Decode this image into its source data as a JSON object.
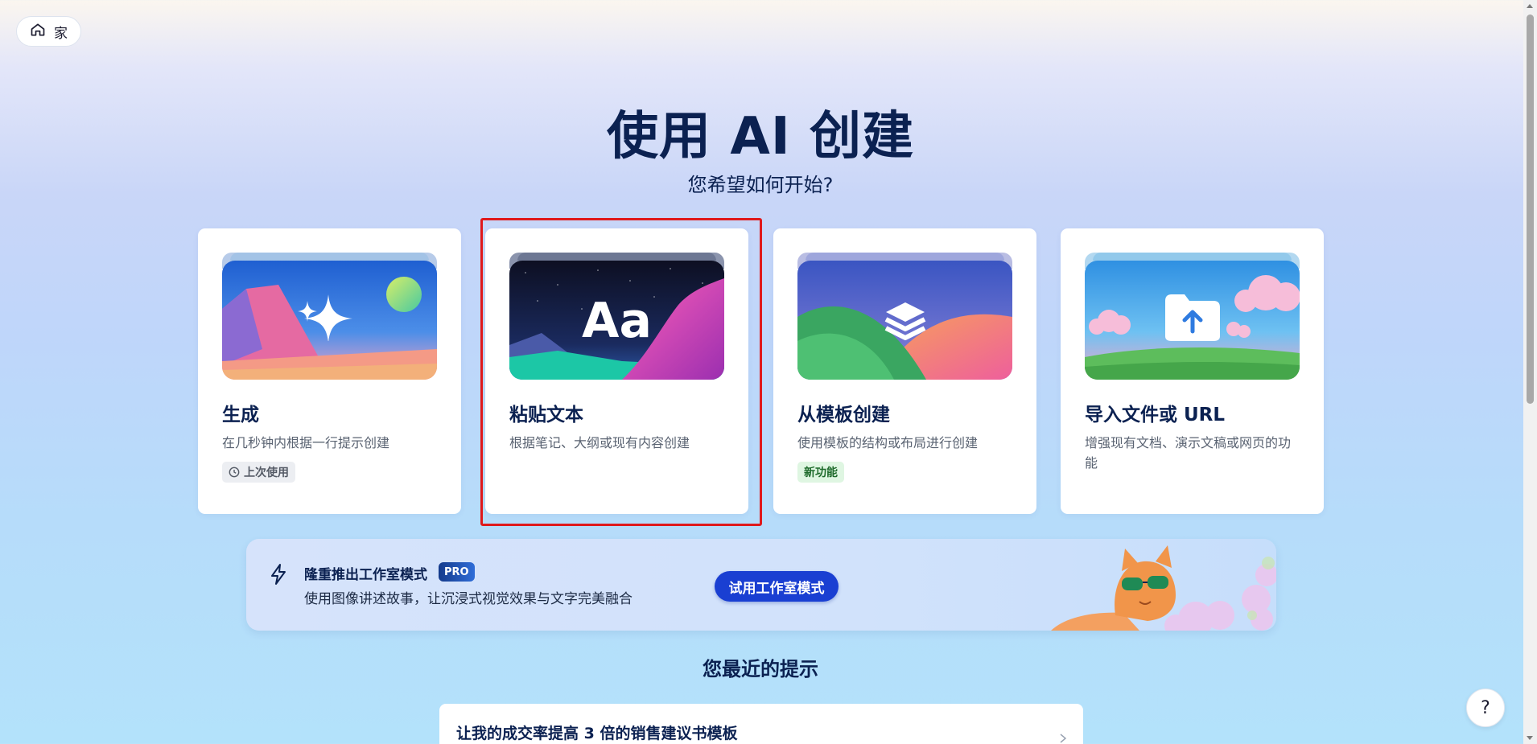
{
  "nav": {
    "home_label": "家",
    "home_icon": "home-icon"
  },
  "hero": {
    "title": "使用 AI 创建",
    "subtitle": "您希望如何开始?"
  },
  "cards": [
    {
      "title": "生成",
      "description": "在几秒钟内根据一行提示创建",
      "badge": "上次使用",
      "badge_icon": "clock-icon",
      "art_icon": "sparkle-icon"
    },
    {
      "title": "粘贴文本",
      "description": "根据笔记、大纲或现有内容创建",
      "art_text": "Aa",
      "selected": true
    },
    {
      "title": "从模板创建",
      "description": "使用模板的结构或布局进行创建",
      "badge": "新功能",
      "art_icon": "layers-icon"
    },
    {
      "title": "导入文件或 URL",
      "description": "增强现有文档、演示文稿或网页的功能",
      "art_icon": "folder-upload-icon"
    }
  ],
  "banner": {
    "icon": "lightning-icon",
    "title": "隆重推出工作室模式",
    "pro_badge": "PRO",
    "description": "使用图像讲述故事，让沉浸式视觉效果与文字完美融合",
    "button_label": "试用工作室模式"
  },
  "recent": {
    "heading": "您最近的提示",
    "items": [
      {
        "label": "让我的成交率提高 3 倍的销售建议书模板"
      }
    ]
  },
  "help": {
    "label": "?"
  },
  "colors": {
    "accent": "#1a3fd2",
    "heading": "#0b2151",
    "selection": "#e0191b"
  }
}
